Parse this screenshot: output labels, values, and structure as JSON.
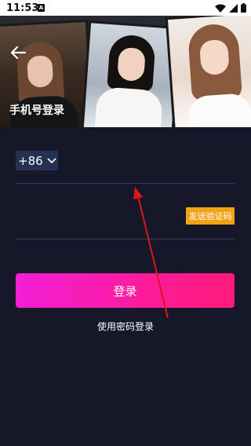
{
  "status_bar": {
    "time": "11:53",
    "notification_glyph": "A",
    "icons": [
      "wifi-icon",
      "signal-icon",
      "battery-icon"
    ]
  },
  "header": {
    "title": "手机号登录",
    "back_icon": "arrow-left-icon"
  },
  "form": {
    "country_code": "+86",
    "phone_placeholder": "",
    "code_placeholder": "",
    "send_code_label": "发送验证码"
  },
  "actions": {
    "login_label": "登录",
    "password_login_label": "使用密码登录"
  },
  "colors": {
    "background": "#17172a",
    "send_code": "#f2a315",
    "login_gradient_start": "#f21fd6",
    "login_gradient_end": "#ff1a7a",
    "country_code_bg": "#253053",
    "annotation_arrow": "#e0141b"
  }
}
